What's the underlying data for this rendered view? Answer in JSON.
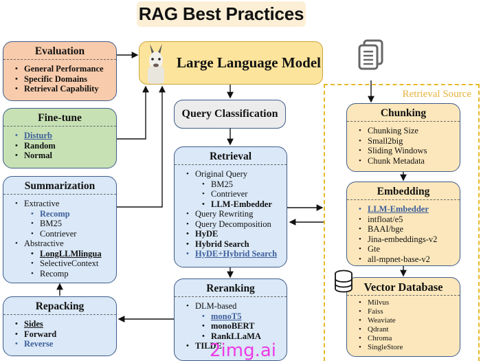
{
  "title": "RAG Best Practices",
  "colors": {
    "evaluation_bg": "#f8cbac",
    "finetune_bg": "#c7e1b5",
    "blue_box_bg": "#dae8f7",
    "yellow_box_bg": "#fbe7bb",
    "llm_bg": "#fde49c",
    "query_class_bg": "#ececec",
    "border": "#3e5b8a",
    "highlight_text": "#3d5f9b",
    "retrieval_source_frame": "#e8b92a",
    "watermark": "#ee3be6"
  },
  "llm": {
    "label": "Large Language Model",
    "icon": "llama-icon"
  },
  "query_classification": {
    "label": "Query Classification"
  },
  "evaluation": {
    "title": "Evaluation",
    "items": [
      "General Performance",
      "Specific Domains",
      "Retrieval Capability"
    ]
  },
  "finetune": {
    "title": "Fine-tune",
    "items": [
      "Disturb",
      "Random",
      "Normal"
    ]
  },
  "summarization": {
    "title": "Summarization",
    "items": [
      "Extractive",
      "Recomp",
      "BM25",
      "Contriever",
      "Abstractive",
      "LongLLMlingua",
      "SelectiveContext",
      "Recomp"
    ]
  },
  "repacking": {
    "title": "Repacking",
    "items": [
      "Sides",
      "Forward",
      "Reverse"
    ]
  },
  "retrieval": {
    "title": "Retrieval",
    "items": [
      "Original Query",
      "BM25",
      "Contriever",
      "LLM-Embedder",
      "Query Rewriting",
      "Query Decomposition",
      "HyDE",
      "Hybrid Search",
      "HyDE+Hybrid Search"
    ]
  },
  "reranking": {
    "title": "Reranking",
    "items": [
      "DLM-based",
      "monoT5",
      "monoBERT",
      "RankLLaMA",
      "TILDE"
    ]
  },
  "retrieval_source": {
    "label": "Retrieval Source",
    "doc_icon": "documents-icon",
    "db_icon": "database-icon"
  },
  "chunking": {
    "title": "Chunking",
    "items": [
      "Chunking Size",
      "Small2big",
      "Sliding Windows",
      "Chunk Metadata"
    ]
  },
  "embedding": {
    "title": "Embedding",
    "items": [
      "LLM-Embedder",
      "intfloat/e5",
      "BAAI/bge",
      "Jina-embeddings-v2",
      "Gte",
      "all-mpnet-base-v2"
    ]
  },
  "vector_db": {
    "title": "Vector Database",
    "items": [
      "Milvus",
      "Faiss",
      "Weaviate",
      "Qdrant",
      "Chroma",
      "SingleStore"
    ]
  },
  "watermark": "2img.ai"
}
